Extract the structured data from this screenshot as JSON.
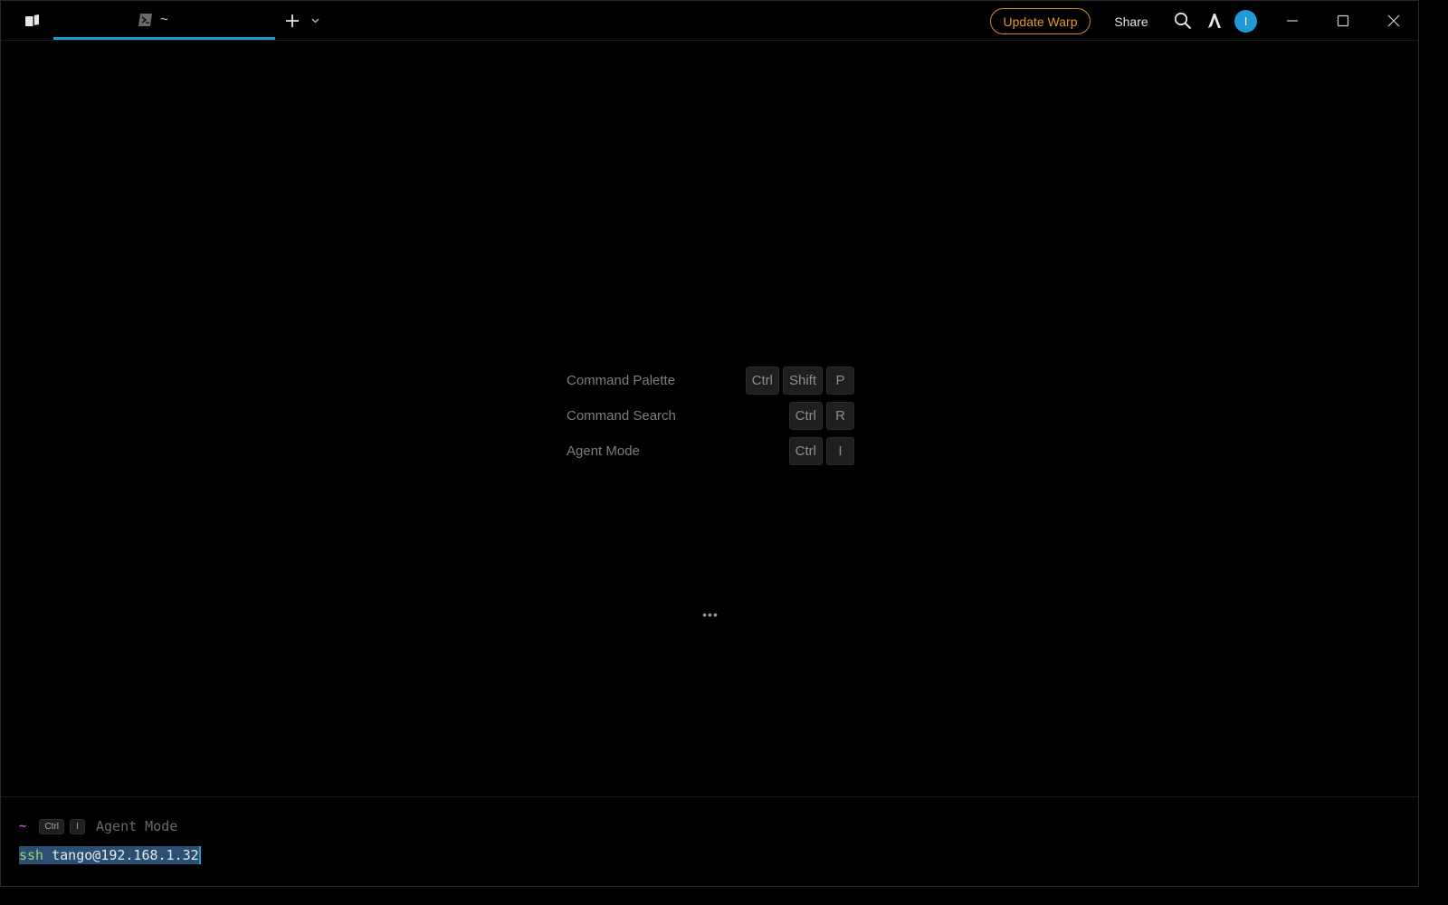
{
  "titlebar": {
    "tab_title": "~",
    "update_label": "Update Warp",
    "share_label": "Share",
    "avatar_initial": "I",
    "accent_color": "#1e9ad6",
    "update_color": "#e3972a"
  },
  "hints": [
    {
      "label": "Command Palette",
      "keys": [
        "Ctrl",
        "Shift",
        "P"
      ]
    },
    {
      "label": "Command Search",
      "keys": [
        "Ctrl",
        "R"
      ]
    },
    {
      "label": "Agent Mode",
      "keys": [
        "Ctrl",
        "I"
      ]
    }
  ],
  "loading_indicator": "•••",
  "input": {
    "prompt_dir": "~",
    "keys": [
      "Ctrl",
      "I"
    ],
    "agent_hint": "Agent Mode",
    "command_name": "ssh",
    "command_args": " tango@192.168.1.32"
  },
  "icons": {
    "sidebar_toggle": "sidebar-icon",
    "tab_shell": "powershell-icon",
    "new_tab": "plus-icon",
    "tab_menu": "chevron-down-icon",
    "search": "search-icon",
    "warp": "warp-logo-icon",
    "minimize": "minimize-icon",
    "maximize": "maximize-icon",
    "close": "close-icon"
  }
}
